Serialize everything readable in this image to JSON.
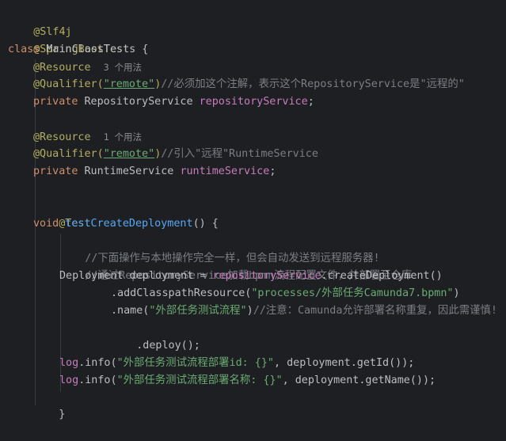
{
  "code": {
    "l1": {
      "ann": "@Slf4j"
    },
    "l2": {
      "ann": "@SpringBootTest"
    },
    "l3": {
      "kw": "class",
      "name": " MainClassTests {"
    },
    "l4": {
      "ann": "@Resource",
      "hint": "3 个用法"
    },
    "l5": {
      "ann": "@Qualifier",
      "open": "(",
      "str": "\"remote\"",
      "close": ")",
      "comment": "//必须加这个注解，表示这个RepositoryService是\"远程的\""
    },
    "l6": {
      "kw": "private",
      "type": " RepositoryService ",
      "field": "repositoryService",
      "end": ";"
    },
    "l8": {
      "ann": "@Resource",
      "hint": "1 个用法"
    },
    "l9": {
      "ann": "@Qualifier",
      "open": "(",
      "str": "\"remote\"",
      "close": ")",
      "comment": "//引入\"远程\"RuntimeService"
    },
    "l10": {
      "kw": "private",
      "type": " RuntimeService ",
      "field": "runtimeService",
      "end": ";"
    },
    "l12": {
      "ann": "@Test"
    },
    "l13": {
      "kw": "void",
      "fn": "testCreateDeployment",
      "end": "() {"
    },
    "l14": {
      "comment": "//下面操作与本地操作完全一样，但会自动发送到远程服务器!"
    },
    "l15": {
      "comment": "//通过RepositoryService加载bpmn流程配置文件，并部署至仓库"
    },
    "l16": {
      "pre": "Deployment deployment = ",
      "field": "repositoryService",
      "post": ".createDeployment()"
    },
    "l17": {
      "pre": ".addClasspathResource(",
      "str": "\"processes/外部任务Camunda7.bpmn\"",
      "post": ")"
    },
    "l18": {
      "pre": ".name(",
      "str": "\"外部任务测试流程\"",
      "post": ")",
      "comment": "//注意：Camunda允许部署名称重复，因此需谨慎!"
    },
    "l19": {
      "pre": ".deploy();"
    },
    "l21": {
      "field": "log",
      "mid": ".info(",
      "str": "\"外部任务测试流程部署id: {}\"",
      "post": ", deployment.getId());"
    },
    "l22": {
      "field": "log",
      "mid": ".info(",
      "str": "\"外部任务测试流程部署名称: {}\"",
      "post": ", deployment.getName());"
    },
    "l23": {
      "brace": "}"
    }
  }
}
